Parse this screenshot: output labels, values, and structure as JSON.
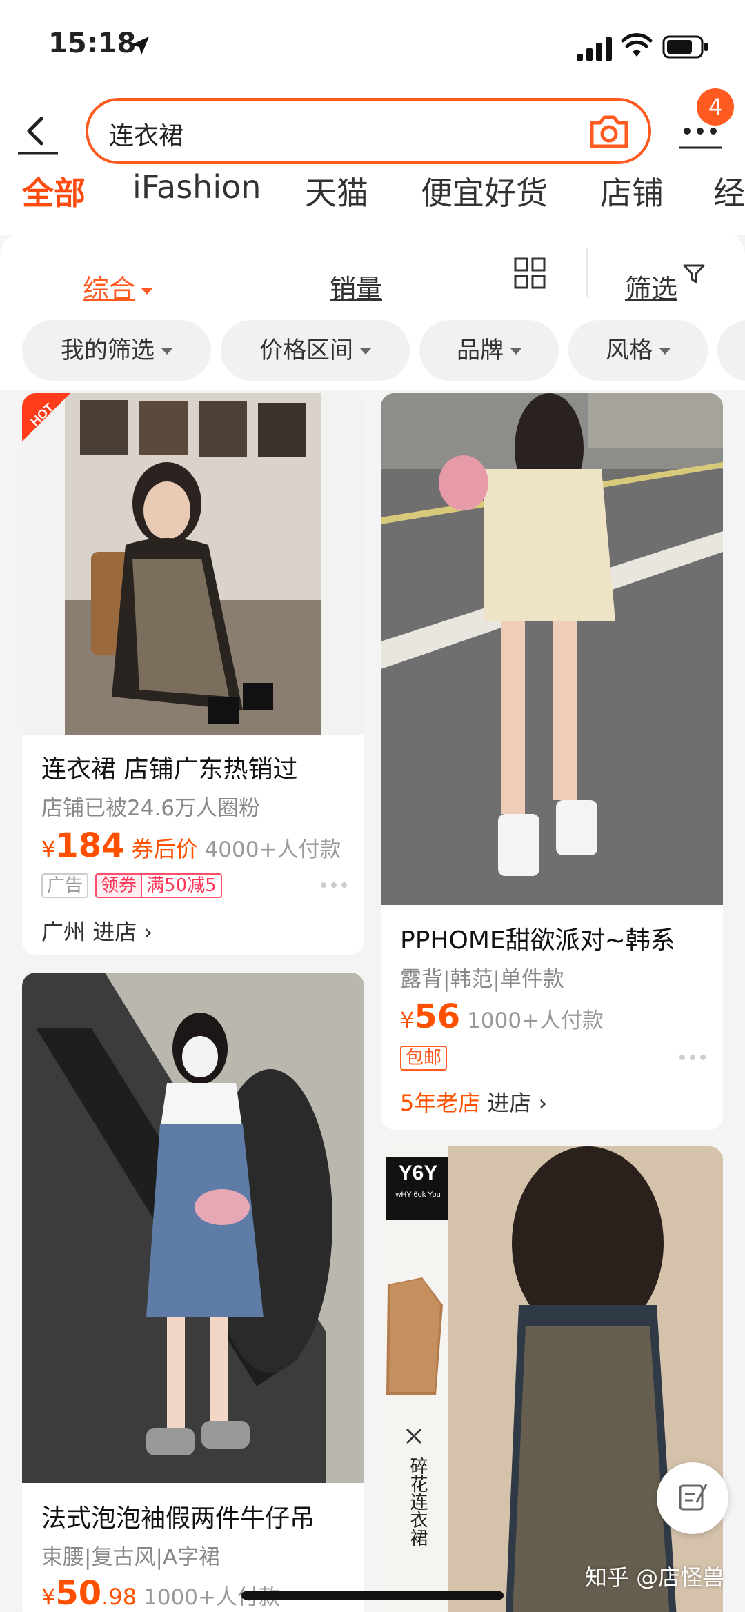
{
  "status_bar": {
    "time": "15:18"
  },
  "search": {
    "query": "连衣裙",
    "badge_count": "4"
  },
  "tabs": [
    "全部",
    "iFashion",
    "天猫",
    "便宜好货",
    "店铺",
    "经"
  ],
  "sort": {
    "comprehensive": "综合",
    "sales": "销量",
    "filter": "筛选"
  },
  "chips": [
    "我的筛选",
    "价格区间",
    "品牌",
    "风格"
  ],
  "colors": {
    "accent": "#ff5a1f",
    "price": "#ff5000"
  },
  "products": [
    {
      "title": "连衣裙 店铺广东热销过",
      "subtitle": "店铺已被24.6万人圈粉",
      "currency": "¥",
      "price": "184",
      "coupon": "券后价",
      "paid": "4000+人付款",
      "tags": [
        "广告",
        "领券",
        "满50减5"
      ],
      "location": "广州",
      "shop_link": "进店",
      "hot_badge": "HOT"
    },
    {
      "title": "PPHOME甜欲派对~韩系",
      "subtitle": "露背|韩范|单件款",
      "currency": "¥",
      "price": "56",
      "paid": "1000+人付款",
      "tags": [
        "包邮"
      ],
      "shop_age": "5年老店",
      "shop_link": "进店"
    },
    {
      "title": "法式泡泡袖假两件牛仔吊",
      "subtitle": "束腰|复古风|A字裙",
      "currency": "¥",
      "price": "50",
      "price_decimal": ".98",
      "paid": "1000+人付款"
    },
    {
      "brand_logo": "Y6Y",
      "brand_sub": "wHY 6ok You",
      "side_label": "碎花连衣裙"
    }
  ],
  "watermark": "知乎 @店怪兽"
}
